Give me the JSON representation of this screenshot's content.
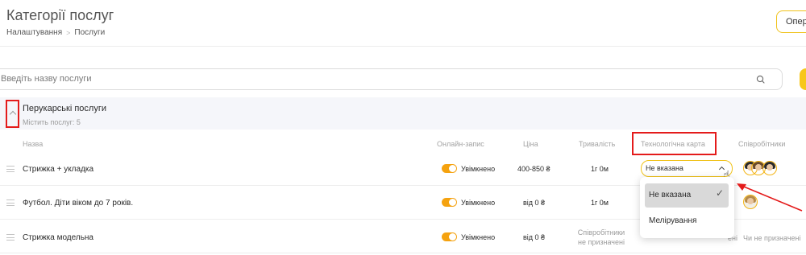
{
  "header": {
    "title": "Категорії послуг",
    "breadcrumb": [
      "Налаштування",
      "Послуги"
    ],
    "breadcrumb_separator": ">",
    "right_button": "Опер"
  },
  "search": {
    "placeholder": "Введіть назву послуги"
  },
  "group": {
    "title": "Перукарські послуги",
    "count_text": "Містить послуг: 5"
  },
  "columns": [
    "Назва",
    "Онлайн-запис",
    "Ціна",
    "Тривалість",
    "Технологічна карта",
    "Співробітники"
  ],
  "services": [
    {
      "name": "Стрижка + укладка",
      "online": "Увімкнено",
      "price": "400-850 ₴",
      "duration": "1г 0м",
      "tech_card": "Не вказана"
    },
    {
      "name": "Футбол. Діти віком до 7 років.",
      "online": "Увімкнено",
      "price": "від 0 ₴",
      "duration": "1г 0м"
    },
    {
      "name": "Стрижка модельна",
      "online": "Увімкнено",
      "price": "від 0 ₴",
      "duration_note": "Співробітники не призначені",
      "tech_card_partial": "ені",
      "employees_note": "Чи не призначені"
    }
  ],
  "dropdown": {
    "options": [
      "Не вказана",
      "Мелірування"
    ],
    "selected": "Не вказана"
  },
  "colors": {
    "accent": "#f7c71b",
    "toggle": "#f5a20f",
    "highlight": "#e41b1b"
  },
  "icons": {
    "search": "search-icon",
    "collapse": "chevron-up-icon",
    "check": "check-icon",
    "drag": "drag-handle-icon"
  }
}
